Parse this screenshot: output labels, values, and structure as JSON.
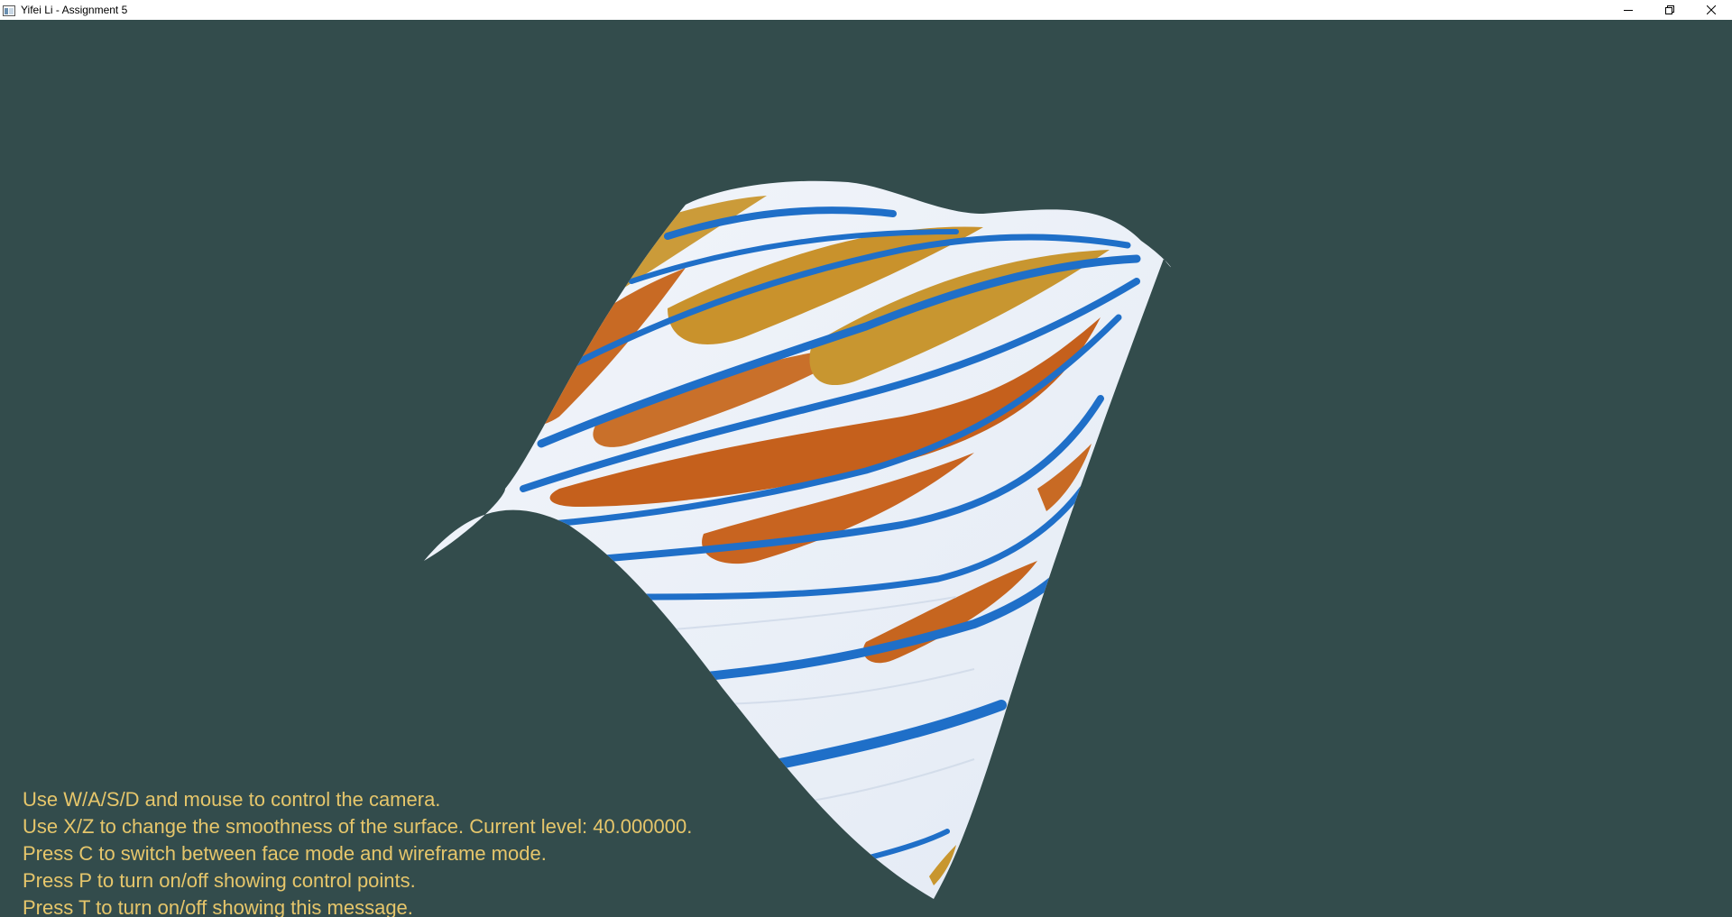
{
  "window": {
    "title": "Yifei Li - Assignment 5",
    "controls": {
      "minimize_icon": "minimize-icon",
      "maximize_icon": "restore-icon",
      "close_icon": "close-icon"
    }
  },
  "viewport": {
    "background_color": "#334c4c",
    "surface_texture": "snow-and-rock-stripes",
    "surface_colors": {
      "snow": "#eef2f8",
      "shadow_blue": "#1f6fc8",
      "rock_orange": "#c8641e",
      "rock_gold": "#c8962e"
    }
  },
  "help": {
    "color": "#e6c66b",
    "lines": [
      "Use W/A/S/D and mouse to control the camera.",
      "Use X/Z to change the smoothness of the surface. Current level: 40.000000.",
      "Press C to switch between face mode and wireframe mode.",
      "Press P to turn on/off showing control points.",
      "Press T to turn on/off showing this message."
    ]
  }
}
